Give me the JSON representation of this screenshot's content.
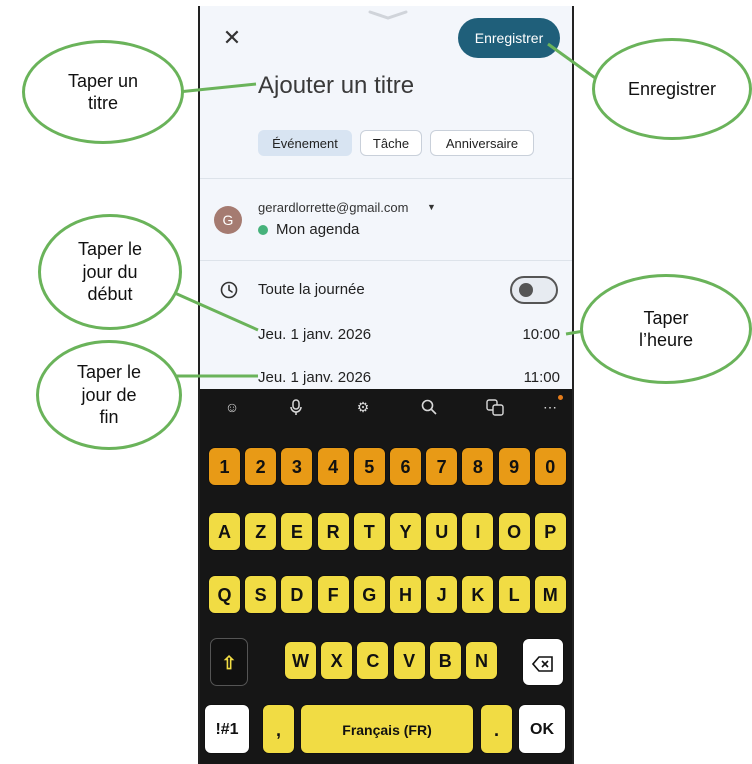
{
  "header": {
    "close_icon": "close-icon",
    "save_label": "Enregistrer"
  },
  "title": {
    "placeholder": "Ajouter un titre"
  },
  "types": [
    "Événement",
    "Tâche",
    "Anniversaire"
  ],
  "account": {
    "avatar_letter": "G",
    "email": "gerardlorrette@gmail.com",
    "calendar": "Mon agenda",
    "calendar_color": "#46b27b"
  },
  "all_day": {
    "label": "Toute la journée",
    "enabled": false
  },
  "start": {
    "date": "Jeu. 1 janv. 2026",
    "time": "10:00"
  },
  "end": {
    "date": "Jeu. 1 janv. 2026",
    "time": "11:00"
  },
  "keyboard": {
    "toolbar_icons": [
      "emoji-icon",
      "mic-icon",
      "settings-icon",
      "search-icon",
      "translate-icon",
      "more-icon"
    ],
    "rows": [
      [
        "1",
        "2",
        "3",
        "4",
        "5",
        "6",
        "7",
        "8",
        "9",
        "0"
      ],
      [
        "A",
        "Z",
        "E",
        "R",
        "T",
        "Y",
        "U",
        "I",
        "O",
        "P"
      ],
      [
        "Q",
        "S",
        "D",
        "F",
        "G",
        "H",
        "J",
        "K",
        "L",
        "M"
      ],
      [
        "W",
        "X",
        "C",
        "V",
        "B",
        "N"
      ]
    ],
    "symbols_label": "!#1",
    "comma": ",",
    "space_label": "Français (FR)",
    "period": ".",
    "ok_label": "OK",
    "number_key_color": "#e89a16",
    "letter_key_color": "#f1dc44"
  },
  "callouts": {
    "title": "Taper un\ntitre",
    "save": "Enregistrer",
    "start_day": "Taper le\njour du\ndébut",
    "end_day": "Taper le\njour de\nfin",
    "time": "Taper\nl’heure",
    "color": "#6ab35a"
  }
}
